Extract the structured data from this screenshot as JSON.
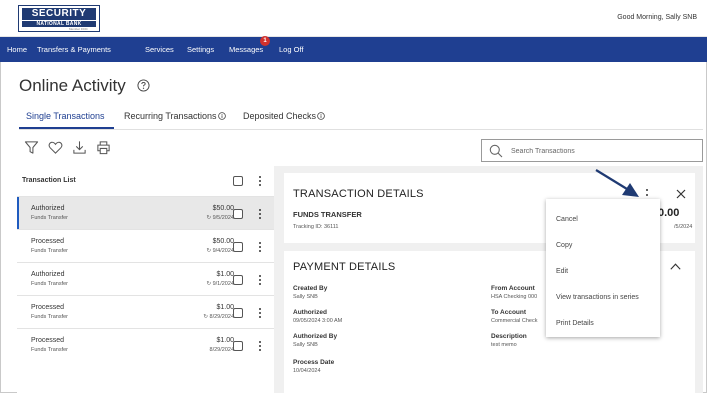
{
  "brand": {
    "line1": "SECURITY",
    "line2": "NATIONAL BANK",
    "line3": "Member FDIC"
  },
  "greeting": "Good Morning, Sally SNB",
  "nav": {
    "items": [
      "Home",
      "Transfers & Payments",
      "Services",
      "Settings",
      "Messages",
      "Log Off"
    ],
    "messages_badge": "1"
  },
  "page_title": "Online Activity",
  "tabs": [
    {
      "label": "Single Transactions",
      "active": true
    },
    {
      "label": "Recurring Transactions",
      "active": false
    },
    {
      "label": "Deposited Checks",
      "active": false
    }
  ],
  "toolbar": {
    "icons": [
      "filter-icon",
      "heart-icon",
      "download-icon",
      "print-icon"
    ],
    "search_placeholder": "Search Transactions"
  },
  "transaction_list": {
    "title": "Transaction List",
    "rows": [
      {
        "status": "Authorized",
        "type": "Funds Transfer",
        "amount": "$50.00",
        "date": "9/5/2024",
        "recurring": true,
        "selected": true
      },
      {
        "status": "Processed",
        "type": "Funds Transfer",
        "amount": "$50.00",
        "date": "9/4/2024",
        "recurring": true,
        "selected": false
      },
      {
        "status": "Authorized",
        "type": "Funds Transfer",
        "amount": "$1.00",
        "date": "9/1/2024",
        "recurring": true,
        "selected": false
      },
      {
        "status": "Processed",
        "type": "Funds Transfer",
        "amount": "$1.00",
        "date": "8/29/2024",
        "recurring": true,
        "selected": false
      },
      {
        "status": "Processed",
        "type": "Funds Transfer",
        "amount": "$1.00",
        "date": "8/29/2024",
        "recurring": false,
        "selected": false
      }
    ]
  },
  "transaction_details": {
    "title": "TRANSACTION DETAILS",
    "subtitle": "FUNDS TRANSFER",
    "tracking": "Tracking ID: 36111",
    "amount_partial": "0.00",
    "date_partial": "/5/2024"
  },
  "payment_details": {
    "title": "PAYMENT DETAILS",
    "left": [
      {
        "label": "Created By",
        "value": "Sally SNB"
      },
      {
        "label": "Authorized",
        "value": "09/05/2024 3:00 AM"
      },
      {
        "label": "Authorized By",
        "value": "Sally SNB"
      },
      {
        "label": "Process Date",
        "value": "10/04/2024"
      }
    ],
    "right": [
      {
        "label": "From Account",
        "value": "HSA Checking 000"
      },
      {
        "label": "To Account",
        "value": "Commercial Check"
      },
      {
        "label": "Description",
        "value": "test memo"
      }
    ]
  },
  "actions_menu": [
    "Cancel",
    "Copy",
    "Edit",
    "View transactions in series",
    "Print Details"
  ],
  "colors": {
    "nav": "#1f3f91",
    "accent": "#1f5bbf",
    "annotation_arrow": "#1f3a73",
    "badge": "#d0312d"
  }
}
